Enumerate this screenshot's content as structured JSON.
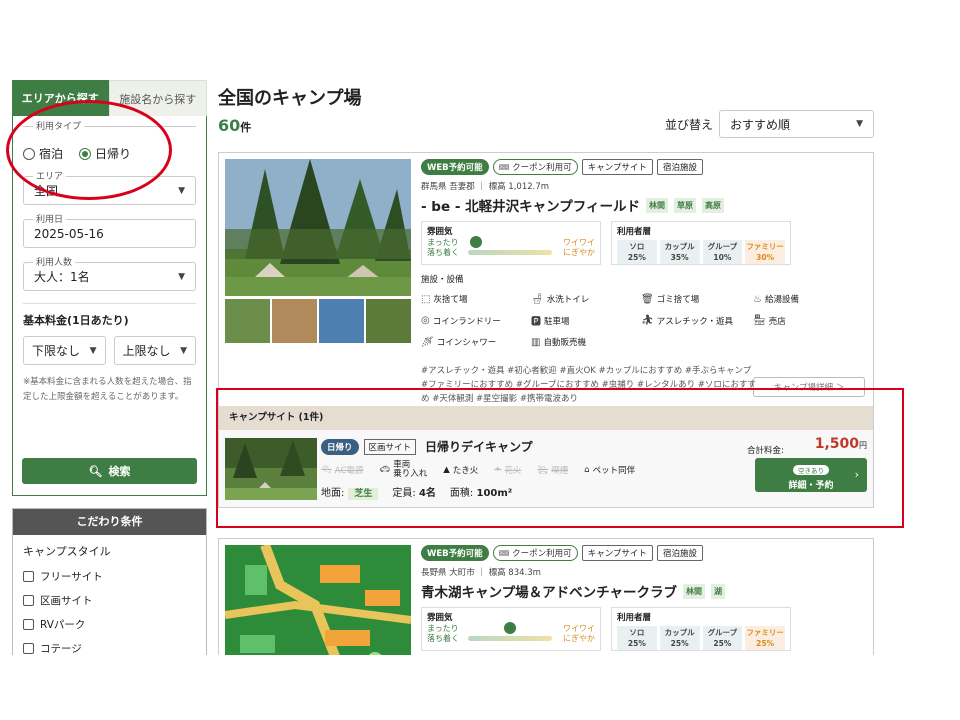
{
  "sidebar": {
    "tabs": [
      {
        "label": "エリアから探す"
      },
      {
        "label": "施設名から探す"
      }
    ],
    "use_type": {
      "label": "利用タイプ",
      "options": [
        "宿泊",
        "日帰り"
      ],
      "selected": "日帰り"
    },
    "area": {
      "label": "エリア",
      "value": "全国"
    },
    "date": {
      "label": "利用日",
      "value": "2025-05-16"
    },
    "people": {
      "label": "利用人数",
      "value": "大人：1名"
    },
    "price": {
      "heading": "基本料金(1日あたり)",
      "min": "下限なし",
      "max": "上限なし",
      "note": "※基本料金に含まれる人数を超えた場合、指定した上限金額を超えることがあります。"
    },
    "search_button": "検索",
    "kodawari": {
      "heading": "こだわり条件",
      "style_heading": "キャンプスタイル",
      "options": [
        "フリーサイト",
        "区画サイト",
        "RVパーク",
        "コテージ"
      ]
    }
  },
  "main": {
    "title": "全国のキャンプ場",
    "count": "60",
    "count_unit": "件",
    "sort": {
      "label": "並び替え",
      "value": "おすすめ順"
    }
  },
  "card1": {
    "badges": [
      "WEB予約可能",
      "クーポン利用可",
      "キャンプサイト",
      "宿泊施設"
    ],
    "location": "群馬県 吾妻郡 ｜ 標高 1,012.7m",
    "name": "- be - 北軽井沢キャンプフィールド",
    "tags": [
      "林間",
      "草原",
      "高原"
    ],
    "atmosphere": {
      "heading": "雰囲気",
      "left": "まったり\n落ち着く",
      "right": "ワイワイ\nにぎやか",
      "position": 0.1
    },
    "users": {
      "heading": "利用者層",
      "items": [
        {
          "label": "ソロ",
          "pct": "25%"
        },
        {
          "label": "カップル",
          "pct": "35%"
        },
        {
          "label": "グループ",
          "pct": "10%"
        },
        {
          "label": "ファミリー",
          "pct": "30%"
        }
      ]
    },
    "facilities_heading": "施設・設備",
    "facilities": [
      "灰捨て場",
      "水洗トイレ",
      "ゴミ捨て場",
      "給湯設備",
      "コインランドリー",
      "駐車場",
      "アスレチック・遊具",
      "売店",
      "コインシャワー",
      "自動販売機"
    ],
    "hashtags": "#アスレチック・遊具 #初心者歓迎 #直火OK #カップルにおすすめ #手ぶらキャンプ #ファミリーにおすすめ #グループにおすすめ #虫捕り #レンタルあり #ソロにおすすめ #天体観測 #星空撮影 #携帯電波あり",
    "detail_button": "キャンプ場詳細 ＞",
    "site_section": "キャンプサイト (1件)",
    "site": {
      "badge_type": "日帰り",
      "badge_category": "区画サイト",
      "name": "日帰りデイキャンプ",
      "features": [
        {
          "label": "AC電源",
          "off": true
        },
        {
          "label": "車両\n乗り入れ",
          "off": false
        },
        {
          "label": "たき火",
          "off": false
        },
        {
          "label": "花火",
          "off": true
        },
        {
          "label": "喫煙",
          "off": true
        },
        {
          "label": "ペット同伴",
          "off": false
        }
      ],
      "ground_label": "地面:",
      "ground": "芝生",
      "capacity_label": "定員:",
      "capacity": "4名",
      "area_label": "面積:",
      "area": "100m²",
      "total_label": "合計料金:",
      "price": "1,500",
      "price_unit": "円",
      "availability": "空きあり",
      "book_button": "詳細・予約"
    }
  },
  "card2": {
    "badges": [
      "WEB予約可能",
      "クーポン利用可",
      "キャンプサイト",
      "宿泊施設"
    ],
    "location": "長野県 大町市 ｜ 標高 834.3m",
    "name": "青木湖キャンプ場＆アドベンチャークラブ",
    "tags": [
      "林間",
      "湖"
    ],
    "atmosphere": {
      "heading": "雰囲気",
      "left": "まったり\n落ち着く",
      "right": "ワイワイ\nにぎやか",
      "position": 0.5
    },
    "users": {
      "heading": "利用者層",
      "items": [
        {
          "label": "ソロ",
          "pct": "25%"
        },
        {
          "label": "カップル",
          "pct": "25%"
        },
        {
          "label": "グループ",
          "pct": "25%"
        },
        {
          "label": "ファミリー",
          "pct": "25%"
        }
      ]
    }
  },
  "colors": {
    "accent": "#3e7d43",
    "highlight": "#d9001b",
    "price": "#c0392b"
  }
}
